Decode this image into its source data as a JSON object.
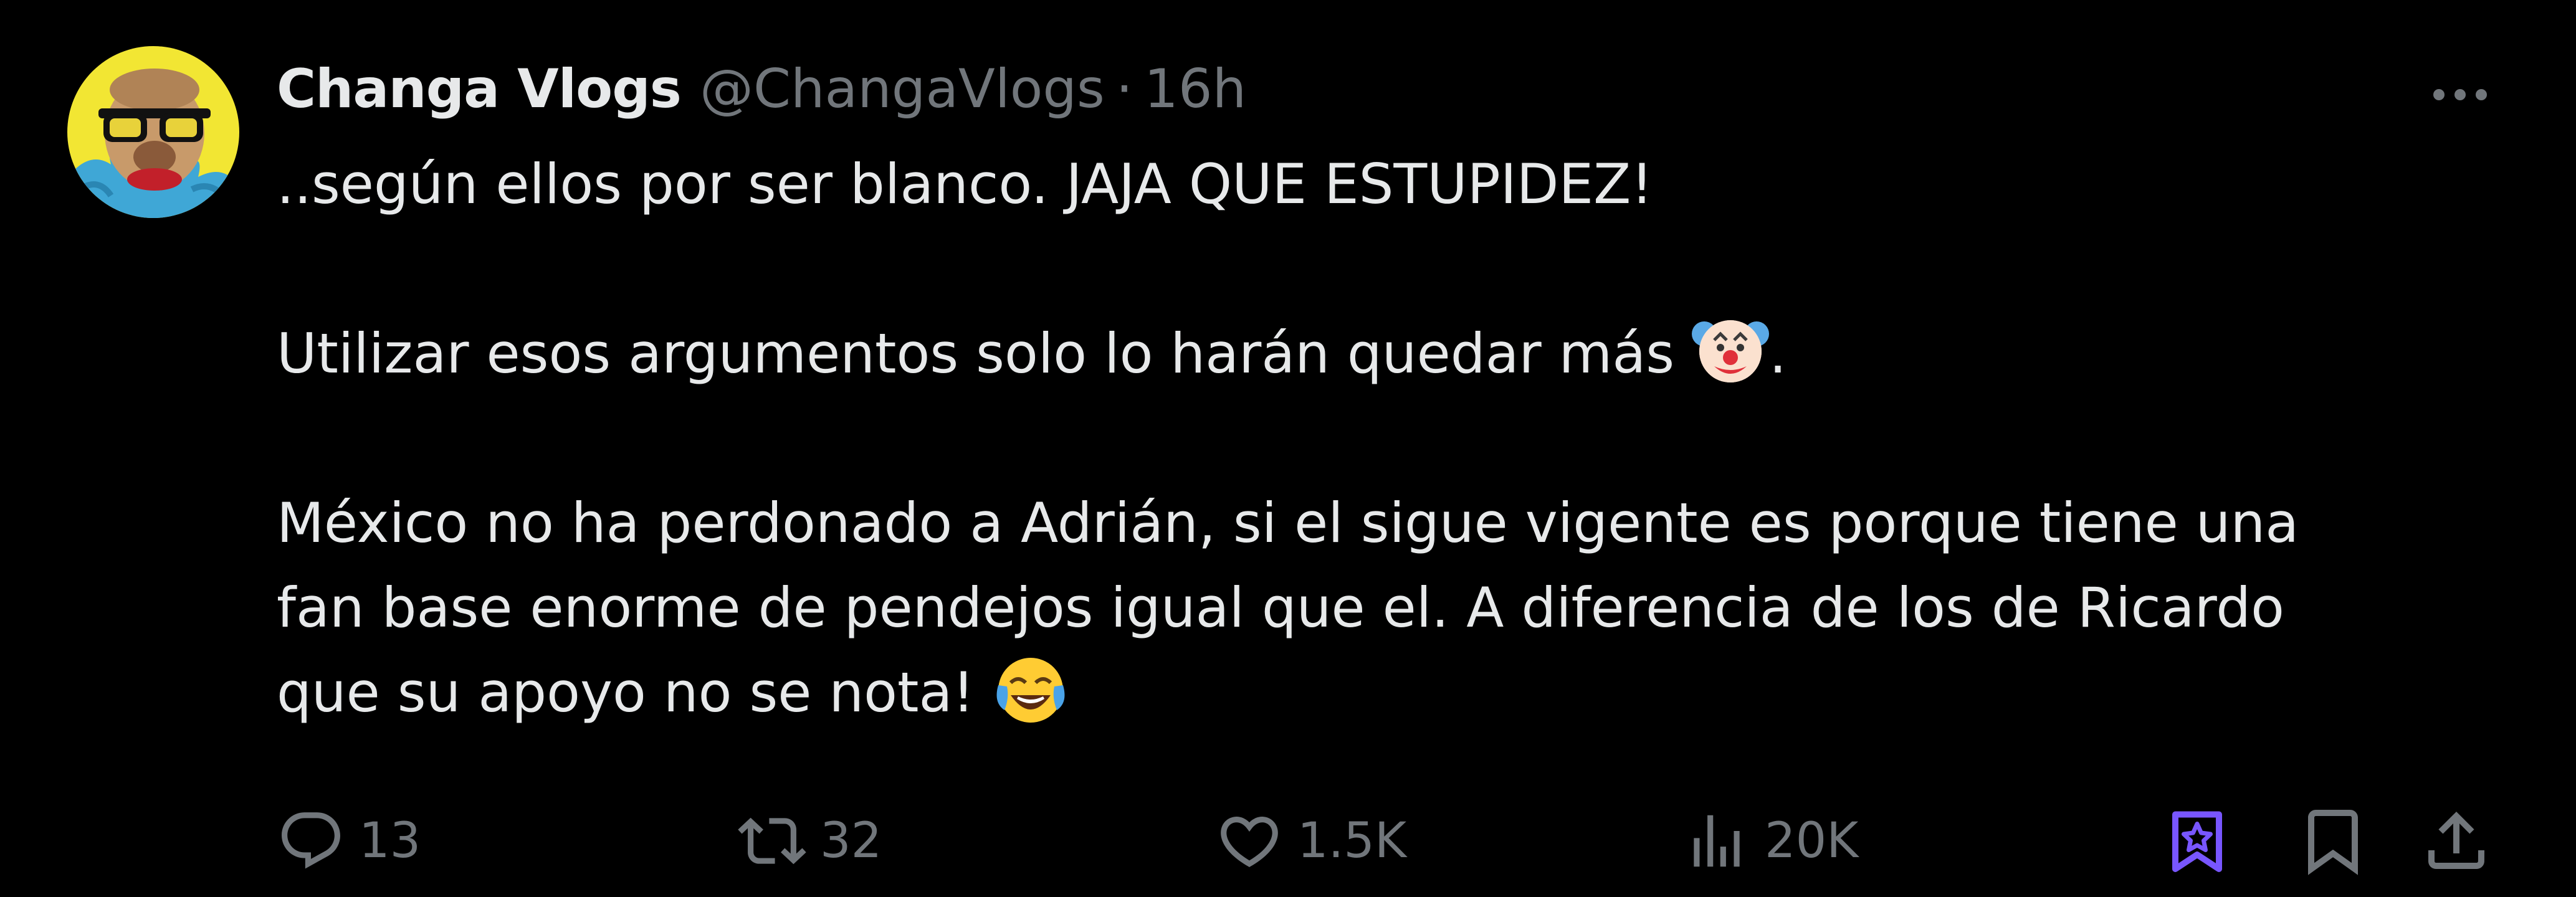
{
  "colors": {
    "background": "#000000",
    "primary_text": "#e7e9ea",
    "secondary_text": "#71767b",
    "grok_accent": "#7856ff"
  },
  "tweet": {
    "author": {
      "display_name": "Changa Vlogs",
      "handle": "@ChangaVlogs",
      "separator": "·",
      "timestamp": "16h"
    },
    "body": {
      "line1": "..según ellos por ser blanco. JAJA QUE ESTUPIDEZ!",
      "line2_text": "Utilizar esos argumentos solo lo harán quedar más ",
      "line2_emoji": "clown-face-emoji",
      "line2_end": ".",
      "line3": "México no ha perdonado a Adrián, si el sigue vigente es porque tiene una",
      "line4": "fan base enorme de pendejos igual que el. A diferencia de los de Ricardo",
      "line5_text": "que su apoyo no se nota! ",
      "line5_emoji": "face-with-tears-of-joy-emoji"
    },
    "actions": {
      "reply_count": "13",
      "retweet_count": "32",
      "like_count": "1.5K",
      "views_count": "20K"
    },
    "icons": {
      "more": "more-horizontal-icon",
      "reply": "reply-bubble-icon",
      "retweet": "retweet-icon",
      "like": "heart-icon",
      "views": "analytics-bars-icon",
      "grok": "grok-bookmark-icon",
      "bookmark": "bookmark-icon",
      "share": "share-upload-icon"
    }
  }
}
